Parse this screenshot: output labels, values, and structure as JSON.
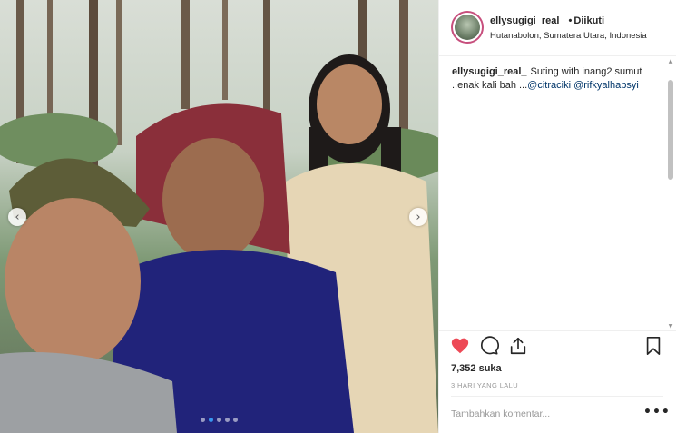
{
  "post": {
    "username": "ellysugigi_real_",
    "follow_separator": "•",
    "follow_label": "Diikuti",
    "location": "Hutanabolon, Sumatera Utara, Indonesia",
    "caption": {
      "username": "ellysugigi_real_",
      "text": "Suting with inang2 sumut ..enak kali bah ...",
      "mentions": [
        "@citraciki",
        "@rifkyalhabsyi"
      ]
    },
    "likes": "7,352 suka",
    "time": "3 HARI YANG LALU",
    "comment_placeholder": "Tambahkan komentar...",
    "more_label": "•••"
  },
  "carousel": {
    "prev_label": "‹",
    "next_label": "›",
    "dots": 5,
    "active_dot": 1
  },
  "icons": {
    "like": "heart-icon-filled",
    "comment": "comment-icon",
    "share": "share-icon",
    "save": "bookmark-icon"
  },
  "colors": {
    "like": "#ed4956",
    "mention": "#003569",
    "avatar_ring": "#c74f7d",
    "active_dot": "#3897f0"
  },
  "scrollbar": {
    "up": "▲",
    "down": "▼"
  }
}
